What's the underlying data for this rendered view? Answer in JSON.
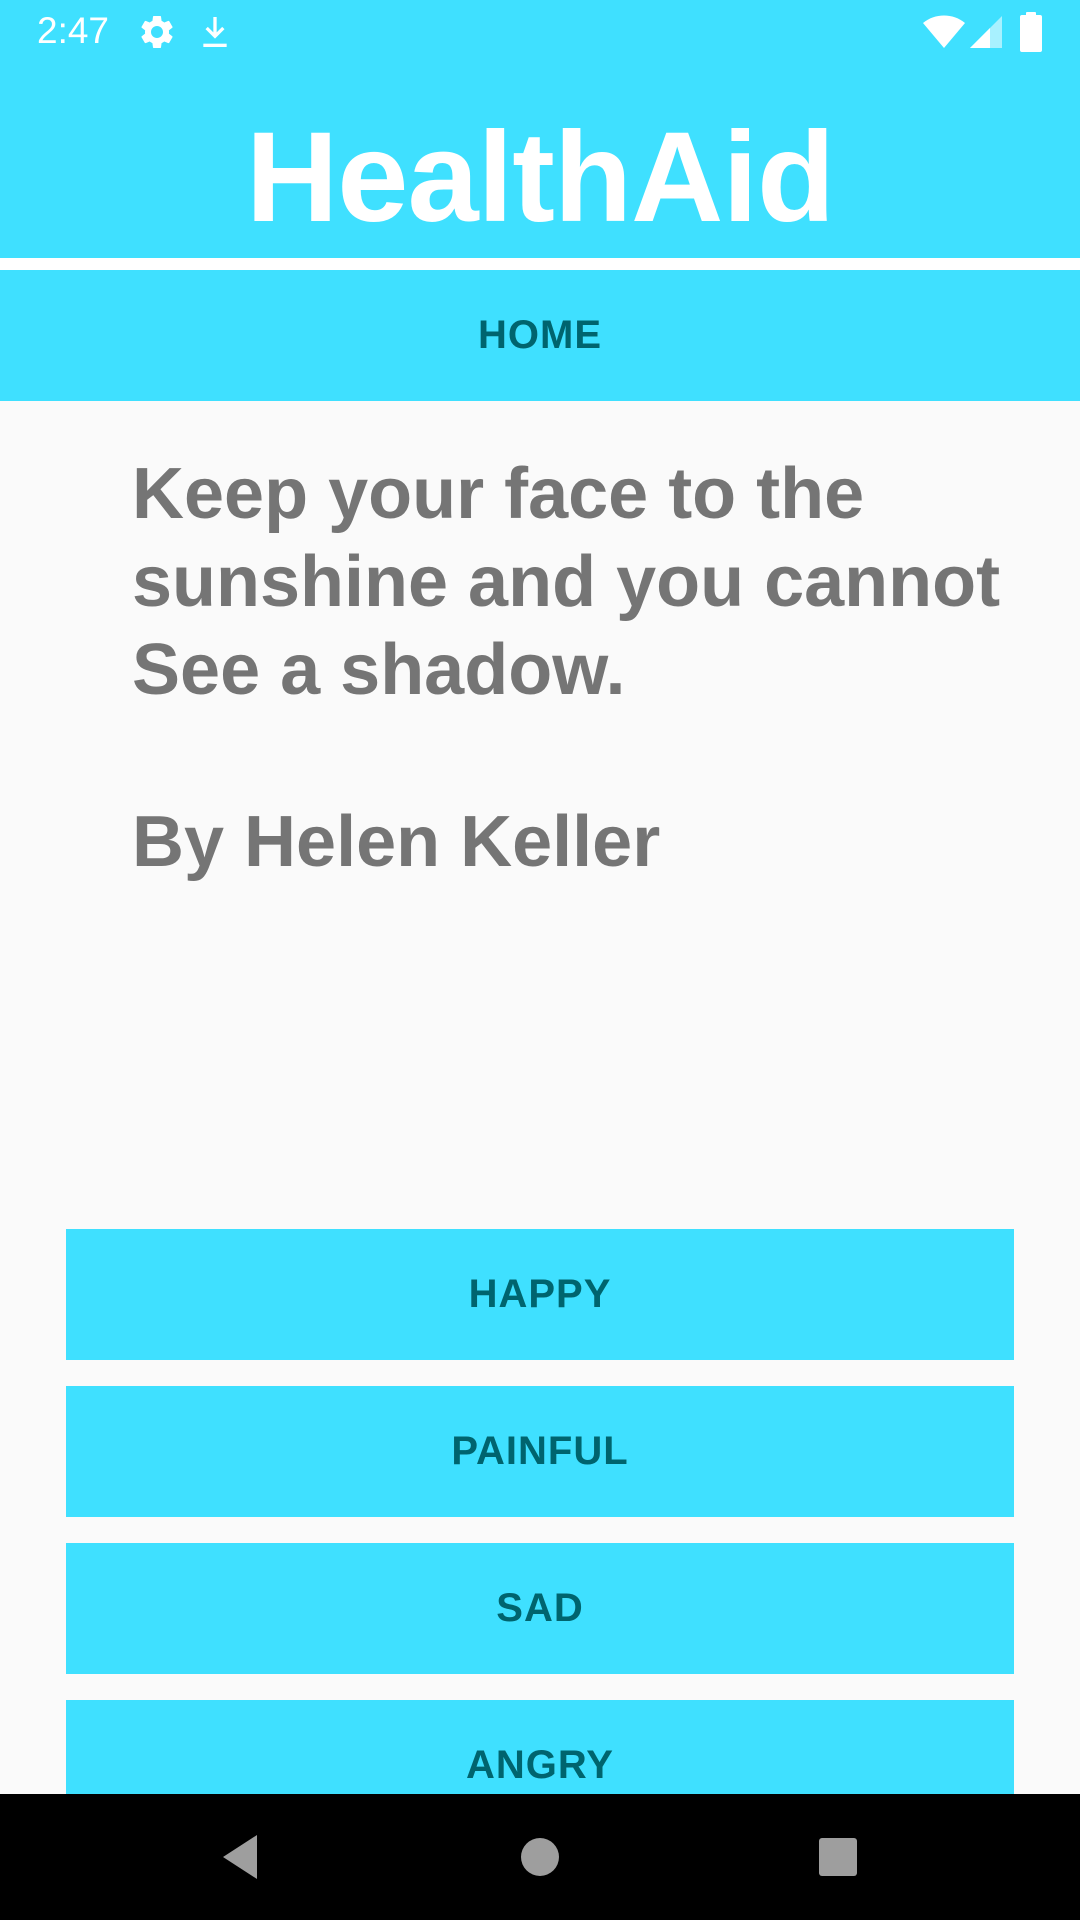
{
  "status_bar": {
    "time": "2:47",
    "icons": [
      "gear-icon",
      "download-icon",
      "wifi-icon",
      "cell-signal-icon",
      "battery-icon"
    ]
  },
  "header": {
    "title": "HealthAid"
  },
  "nav": {
    "home_label": "HOME"
  },
  "quote": {
    "lines": [
      "Keep your face to the",
      "sunshine and you cannot",
      "See a shadow."
    ],
    "author": "By Helen Keller"
  },
  "moods": [
    {
      "label": "HAPPY"
    },
    {
      "label": "PAINFUL"
    },
    {
      "label": "SAD"
    },
    {
      "label": "ANGRY"
    }
  ],
  "system_nav": {
    "icons": [
      "back-icon",
      "home-icon",
      "recents-icon"
    ]
  },
  "colors": {
    "accent": "#3FE0FF",
    "button_text": "#00646E",
    "quote_text": "#757575",
    "background": "#FAFAFA"
  }
}
